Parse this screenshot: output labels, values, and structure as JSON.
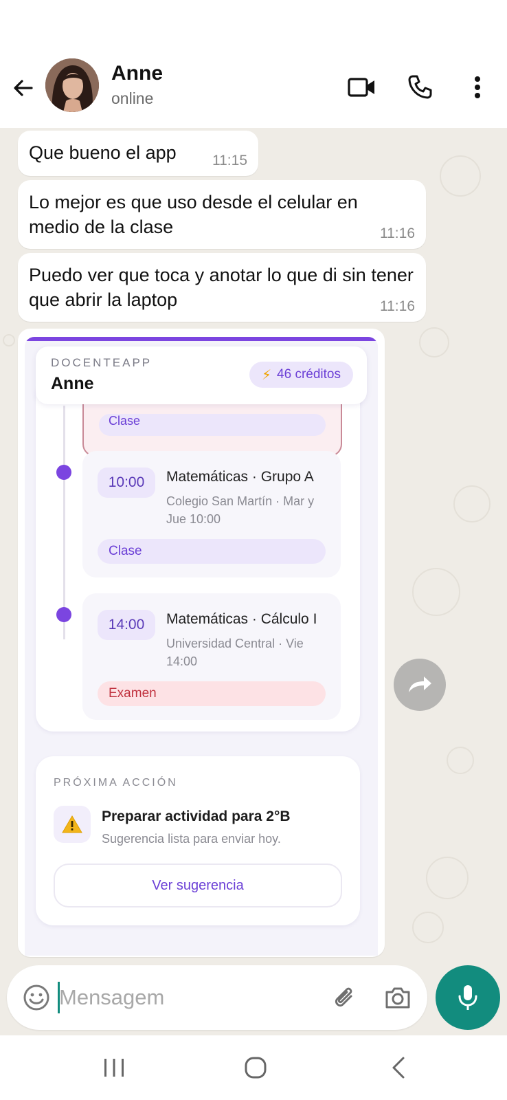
{
  "header": {
    "contact_name": "Anne",
    "contact_status": "online",
    "icons": [
      "back-arrow-icon",
      "video-call-icon",
      "phone-icon",
      "more-vertical-icon"
    ]
  },
  "messages": [
    {
      "text": "Que bueno el app",
      "time": "11:15"
    },
    {
      "text": "Lo mejor es que uso desde el celular en medio de la clase",
      "time": "11:16"
    },
    {
      "text": "Puedo ver que toca y anotar lo que di sin tener que abrir la laptop",
      "time": "11:16"
    }
  ],
  "shared_screenshot": {
    "brand": "DOCENTEAPP",
    "user": "Anne",
    "credits": "46 créditos",
    "previous_chip": "Clase",
    "events": [
      {
        "time": "10:00",
        "title": "Matemáticas · Grupo A",
        "subtitle": "Colegio San Martín · Mar y Jue 10:00",
        "tag": "Clase"
      },
      {
        "time": "14:00",
        "title": "Matemáticas · Cálculo I",
        "subtitle": "Universidad Central · Vie 14:00",
        "tag": "Examen"
      }
    ],
    "next_action": {
      "label": "PRÓXIMA ACCIÓN",
      "title": "Preparar actividad para 2°B",
      "subtitle": "Sugerencia lista para enviar hoy.",
      "button": "Ver sugerencia"
    },
    "colors": {
      "accent": "#7b45e0",
      "exam": "#c0313e"
    }
  },
  "composer": {
    "placeholder": "Mensagem",
    "value": ""
  },
  "colors": {
    "chat_background": "#efece6",
    "whatsapp_green": "#128c7e"
  }
}
